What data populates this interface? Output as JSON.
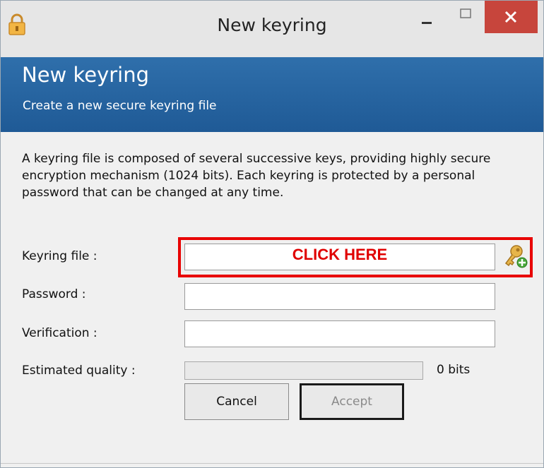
{
  "window": {
    "title": "New keyring",
    "controls": {
      "minimize": "–",
      "maximize": "□",
      "close": "✕"
    },
    "app_icon": "padlock-icon"
  },
  "banner": {
    "title": "New keyring",
    "subtitle": "Create a new secure keyring file",
    "color": "#1f5a96"
  },
  "description": "A keyring file is composed of several successive keys, providing highly secure encryption mechanism (1024 bits). Each keyring is protected by a personal password that can be changed at any time.",
  "form": {
    "keyring_label": "Keyring file :",
    "keyring_value": "",
    "keyring_overlay": "CLICK HERE",
    "keyring_icon": "key-add-icon",
    "password_label": "Password :",
    "password_value": "",
    "verification_label": "Verification :",
    "verification_value": "",
    "quality_label": "Estimated quality :",
    "quality_fraction": 0,
    "quality_text": "0 bits"
  },
  "buttons": {
    "cancel": "Cancel",
    "accept": "Accept"
  },
  "colors": {
    "highlight": "#e80000",
    "accent": "#2f6fab",
    "close": "#c7453c"
  }
}
